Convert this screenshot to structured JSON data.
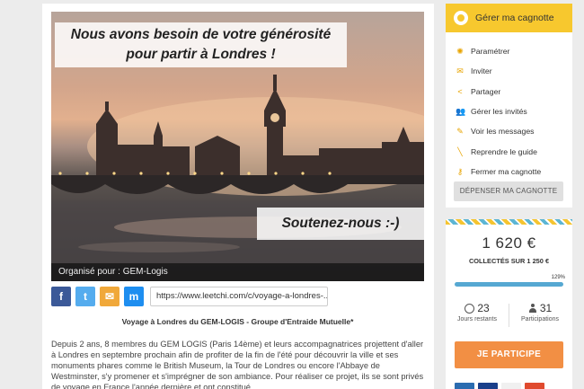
{
  "hero": {
    "title_line1": "Nous avons besoin de votre générosité",
    "title_line2": "pour partir à Londres !",
    "subtitle": "Soutenez-nous :-)",
    "organizer": "Organisé pour : GEM-Logis"
  },
  "share": {
    "facebook": "f",
    "twitter": "t",
    "email": "✉",
    "messenger": "m",
    "url": "https://www.leetchi.com/c/voyage-a-londres-..."
  },
  "project": {
    "title": "Voyage à Londres du GEM-LOGIS - Groupe d'Entraide Mutuelle*",
    "description": "Depuis 2 ans, 8 membres du GEM LOGIS (Paris 14ème) et leurs accompagnatrices projettent d'aller à Londres en septembre prochain afin de profiter de la fin de l'été pour découvrir la ville et ses monuments phares comme le British Museum, la Tour de Londres ou encore l'Abbaye de Westminster, s'y promener et s'imprégner de son ambiance. Pour réaliser ce projet, ils se sont privés de voyage en France l'année dernière et ont constitué"
  },
  "manage": {
    "header": "Gérer ma cagnotte",
    "items": [
      {
        "label": "Paramétrer",
        "icon": "gear-icon",
        "glyph": "✺"
      },
      {
        "label": "Inviter",
        "icon": "envelope-icon",
        "glyph": "✉"
      },
      {
        "label": "Partager",
        "icon": "share-icon",
        "glyph": "<"
      },
      {
        "label": "Gérer les invités",
        "icon": "users-icon",
        "glyph": "👥"
      },
      {
        "label": "Voir les messages",
        "icon": "message-icon",
        "glyph": "✎"
      },
      {
        "label": "Reprendre le guide",
        "icon": "wand-icon",
        "glyph": "╲"
      },
      {
        "label": "Fermer ma cagnotte",
        "icon": "key-icon",
        "glyph": "⚷"
      }
    ],
    "spend_button": "DÉPENSER MA CAGNOTTE"
  },
  "stats": {
    "amount": "1 620 €",
    "collected": "COLLECTÉS SUR 1 250 €",
    "percent_label": "129%",
    "progress_fraction": 1.0,
    "days_value": "23",
    "days_label": "Jours restants",
    "participants_value": "31",
    "participants_label": "Participations",
    "participate_button": "JE PARTICIPE"
  },
  "colors": {
    "accent_yellow": "#f7c82e",
    "participate_orange": "#f28f44",
    "progress_blue": "#56a8d2",
    "facebook": "#3b5998",
    "twitter": "#55acee"
  }
}
